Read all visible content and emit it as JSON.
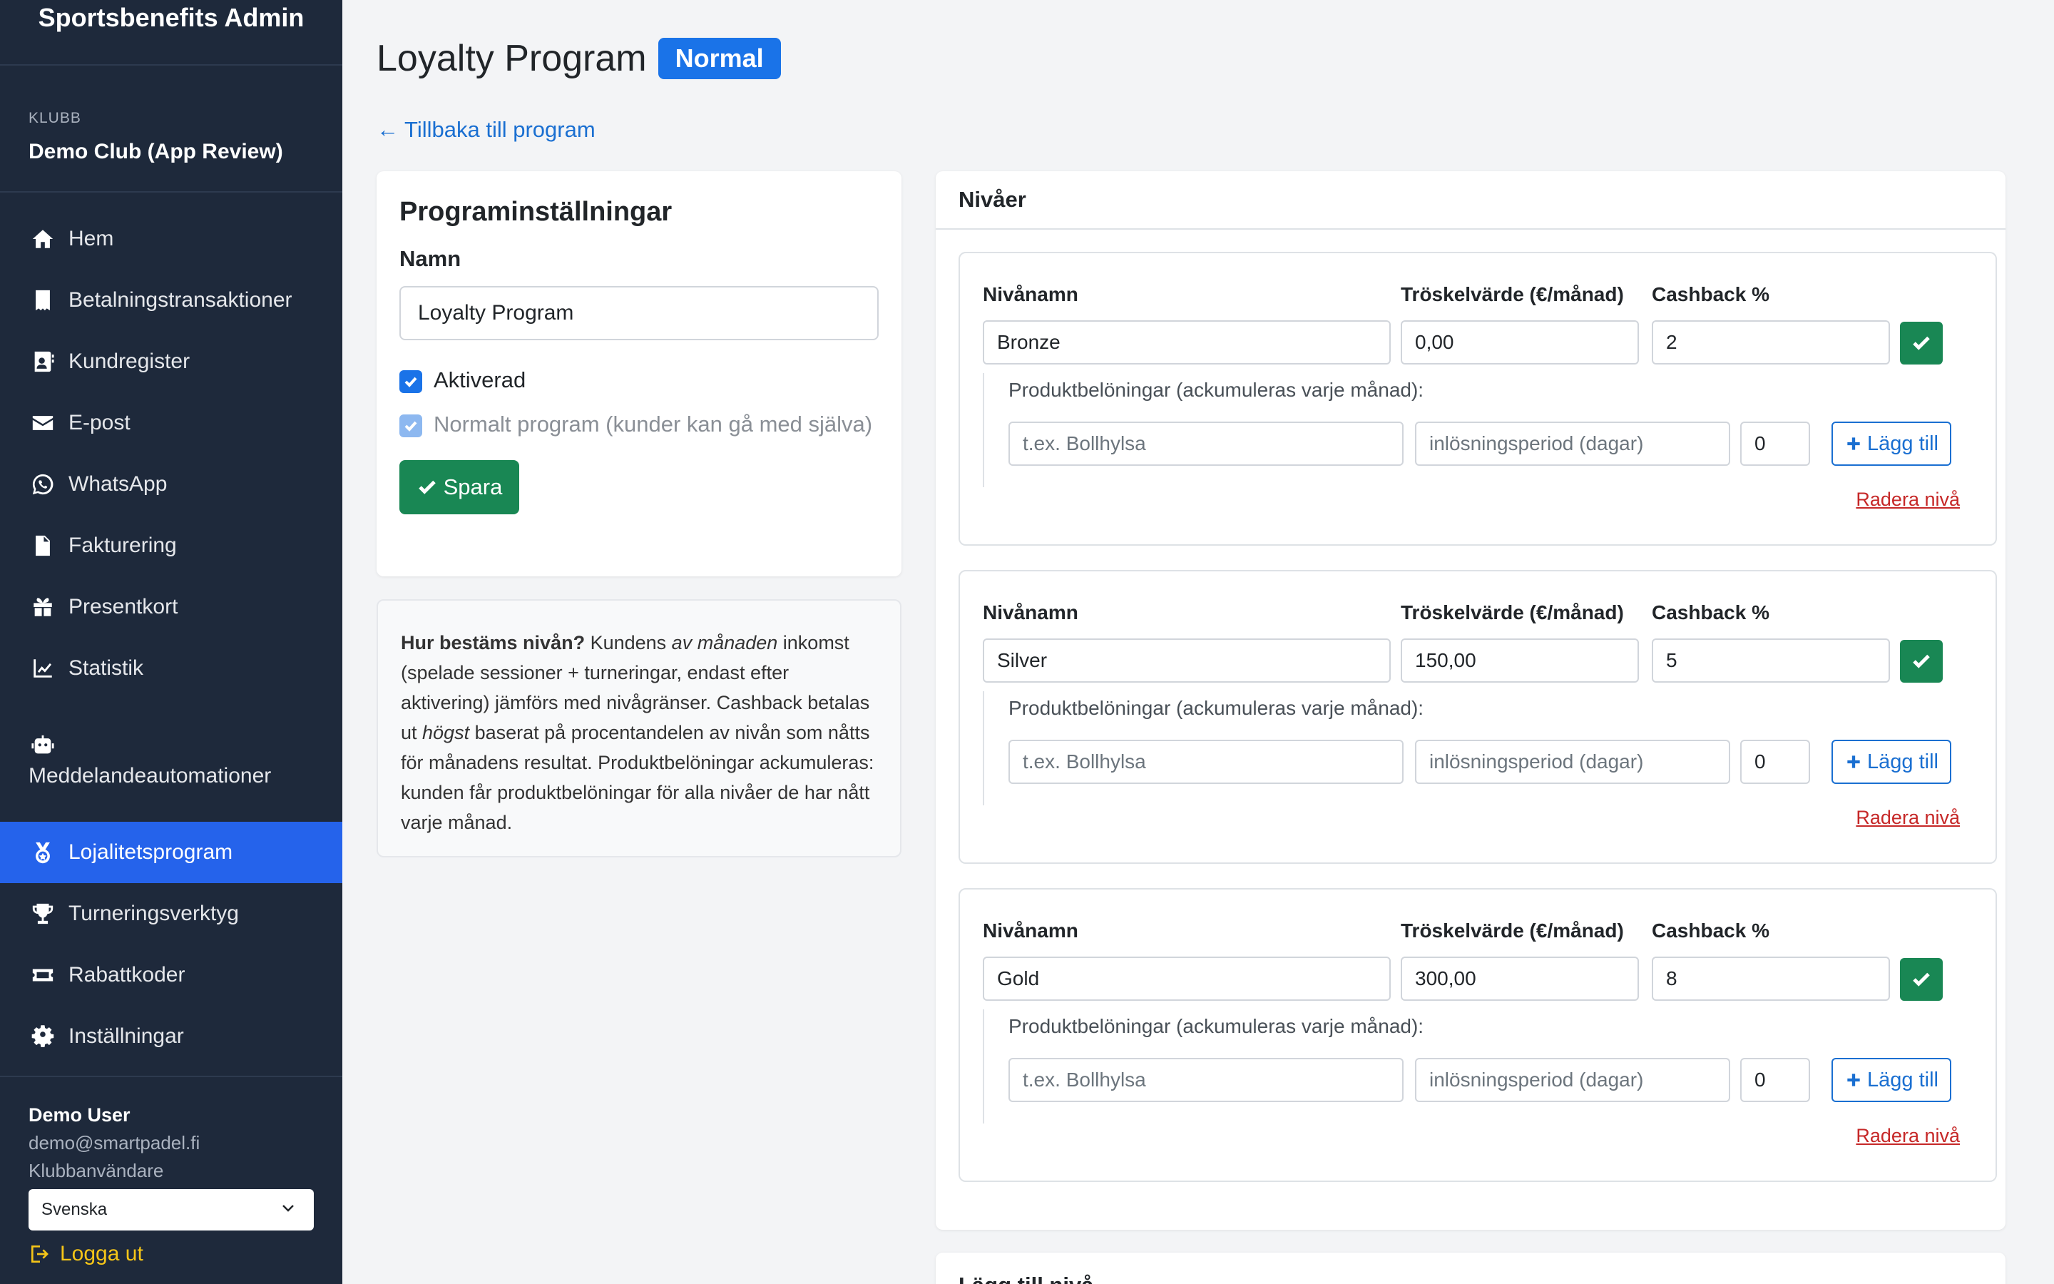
{
  "app": {
    "title": "Sportsbenefits Admin"
  },
  "club": {
    "label": "KLUBB",
    "name": "Demo Club (App Review)"
  },
  "nav": {
    "items": [
      {
        "label": "Hem",
        "icon": "home-icon"
      },
      {
        "label": "Betalningstransaktioner",
        "icon": "receipt-icon"
      },
      {
        "label": "Kundregister",
        "icon": "contact-card-icon"
      },
      {
        "label": "E-post",
        "icon": "envelope-icon"
      },
      {
        "label": "WhatsApp",
        "icon": "whatsapp-icon"
      },
      {
        "label": "Fakturering",
        "icon": "invoice-icon"
      },
      {
        "label": "Presentkort",
        "icon": "gift-icon"
      },
      {
        "label": "Statistik",
        "icon": "chart-line-icon"
      },
      {
        "label": "Meddelandeautomationer",
        "icon": "robot-icon"
      },
      {
        "label": "Lojalitetsprogram",
        "icon": "medal-icon",
        "active": true
      },
      {
        "label": "Turneringsverktyg",
        "icon": "trophy-icon"
      },
      {
        "label": "Rabattkoder",
        "icon": "ticket-icon"
      },
      {
        "label": "Inställningar",
        "icon": "gear-icon"
      }
    ]
  },
  "user": {
    "name": "Demo User",
    "email": "demo@smartpadel.fi",
    "role": "Klubbanvändare"
  },
  "language": {
    "selected": "Svenska"
  },
  "logout": {
    "label": "Logga ut"
  },
  "page": {
    "title": "Loyalty Program",
    "badge": "Normal",
    "back_link": "← Tillbaka till program"
  },
  "settings": {
    "title": "Programinställningar",
    "name_label": "Namn",
    "name_value": "Loyalty Program",
    "enabled_label": "Aktiverad",
    "normal_label": "Normalt program (kunder kan gå med själva)",
    "save_label": "Spara"
  },
  "info": {
    "strong": "Hur bestäms nivån?",
    "t1": " Kundens ",
    "em1": "av månaden",
    "t2": " inkomst (spelade sessioner + turneringar, endast efter aktivering) jämförs med nivågränser. Cashback betalas ut ",
    "em2": "högst",
    "t3": " baserat på procentandelen av nivån som nåtts för månadens resultat. Produktbelöningar ackumuleras: kunden får produktbelöningar för alla nivåer de har nått varje månad."
  },
  "levels": {
    "title": "Nivåer",
    "labels": {
      "name": "Nivånamn",
      "threshold": "Tröskelvärde (€/månad)",
      "cashback": "Cashback %",
      "rewards": "Produktbelöningar (ackumuleras varje månad):",
      "reward_placeholder": "t.ex. Bollhylsa",
      "period_placeholder": "inlösningsperiod (dagar)",
      "add": "Lägg till",
      "delete": "Radera nivå"
    },
    "items": [
      {
        "name": "Bronze",
        "threshold": "0,00",
        "cashback": "2",
        "qty": "0"
      },
      {
        "name": "Silver",
        "threshold": "150,00",
        "cashback": "5",
        "qty": "0"
      },
      {
        "name": "Gold",
        "threshold": "300,00",
        "cashback": "8",
        "qty": "0"
      }
    ]
  },
  "add_level": {
    "title": "Lägg till nivå"
  },
  "colors": {
    "sidebar": "#1e293b",
    "active": "#2563eb",
    "success": "#198754",
    "link": "#1a6fd1",
    "danger": "#c62828",
    "logout": "#f5c518"
  }
}
